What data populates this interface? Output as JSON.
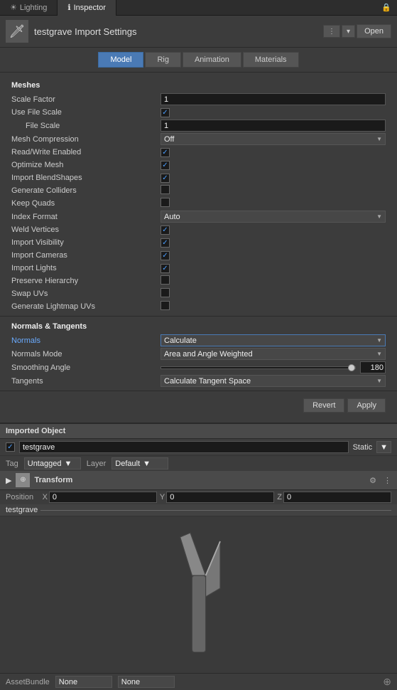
{
  "tabs": [
    {
      "id": "lighting",
      "label": "Lighting",
      "active": false
    },
    {
      "id": "inspector",
      "label": "Inspector",
      "active": true
    }
  ],
  "header": {
    "title": "testgrave Import Settings",
    "open_label": "Open"
  },
  "section_tabs": [
    {
      "id": "model",
      "label": "Model",
      "active": true
    },
    {
      "id": "rig",
      "label": "Rig",
      "active": false
    },
    {
      "id": "animation",
      "label": "Animation",
      "active": false
    },
    {
      "id": "materials",
      "label": "Materials",
      "active": false
    }
  ],
  "meshes": {
    "heading": "Meshes",
    "fields": [
      {
        "label": "Scale Factor",
        "type": "text",
        "value": "1"
      },
      {
        "label": "Use File Scale",
        "type": "checkbox",
        "checked": true
      },
      {
        "label": "File Scale",
        "type": "text",
        "value": "1",
        "indented": true
      },
      {
        "label": "Mesh Compression",
        "type": "dropdown",
        "value": "Off"
      },
      {
        "label": "Read/Write Enabled",
        "type": "checkbox",
        "checked": true
      },
      {
        "label": "Optimize Mesh",
        "type": "checkbox",
        "checked": true
      },
      {
        "label": "Import BlendShapes",
        "type": "checkbox",
        "checked": true
      },
      {
        "label": "Generate Colliders",
        "type": "checkbox",
        "checked": false
      },
      {
        "label": "Keep Quads",
        "type": "checkbox",
        "checked": false
      },
      {
        "label": "Index Format",
        "type": "dropdown",
        "value": "Auto"
      },
      {
        "label": "Weld Vertices",
        "type": "checkbox",
        "checked": true
      },
      {
        "label": "Import Visibility",
        "type": "checkbox",
        "checked": true
      },
      {
        "label": "Import Cameras",
        "type": "checkbox",
        "checked": true
      },
      {
        "label": "Import Lights",
        "type": "checkbox",
        "checked": true
      },
      {
        "label": "Preserve Hierarchy",
        "type": "checkbox",
        "checked": false
      },
      {
        "label": "Swap UVs",
        "type": "checkbox",
        "checked": false
      },
      {
        "label": "Generate Lightmap UVs",
        "type": "checkbox",
        "checked": false
      }
    ]
  },
  "normals_tangents": {
    "heading": "Normals & Tangents",
    "fields": [
      {
        "label": "Normals",
        "type": "dropdown",
        "value": "Calculate",
        "highlighted": true
      },
      {
        "label": "Normals Mode",
        "type": "dropdown",
        "value": "Area and Angle Weighted"
      },
      {
        "label": "Smoothing Angle",
        "type": "slider",
        "value": 180,
        "min": 0,
        "max": 180
      },
      {
        "label": "Tangents",
        "type": "dropdown",
        "value": "Calculate Tangent Space"
      }
    ]
  },
  "buttons": {
    "revert": "Revert",
    "apply": "Apply"
  },
  "imported_object": {
    "heading": "Imported Object",
    "object_name": "testgrave",
    "static_label": "Static",
    "tag_label": "Tag",
    "tag_value": "Untagged",
    "layer_label": "Layer",
    "layer_value": "Default"
  },
  "transform": {
    "heading": "Transform",
    "position_label": "Position",
    "x_label": "X",
    "x_value": "0",
    "y_label": "Y",
    "y_value": "0",
    "z_label": "Z",
    "z_value": "0"
  },
  "object_name_display": "testgrave",
  "bottom_bar": {
    "label": "AssetBundle",
    "value1": "None",
    "value2": "None"
  }
}
